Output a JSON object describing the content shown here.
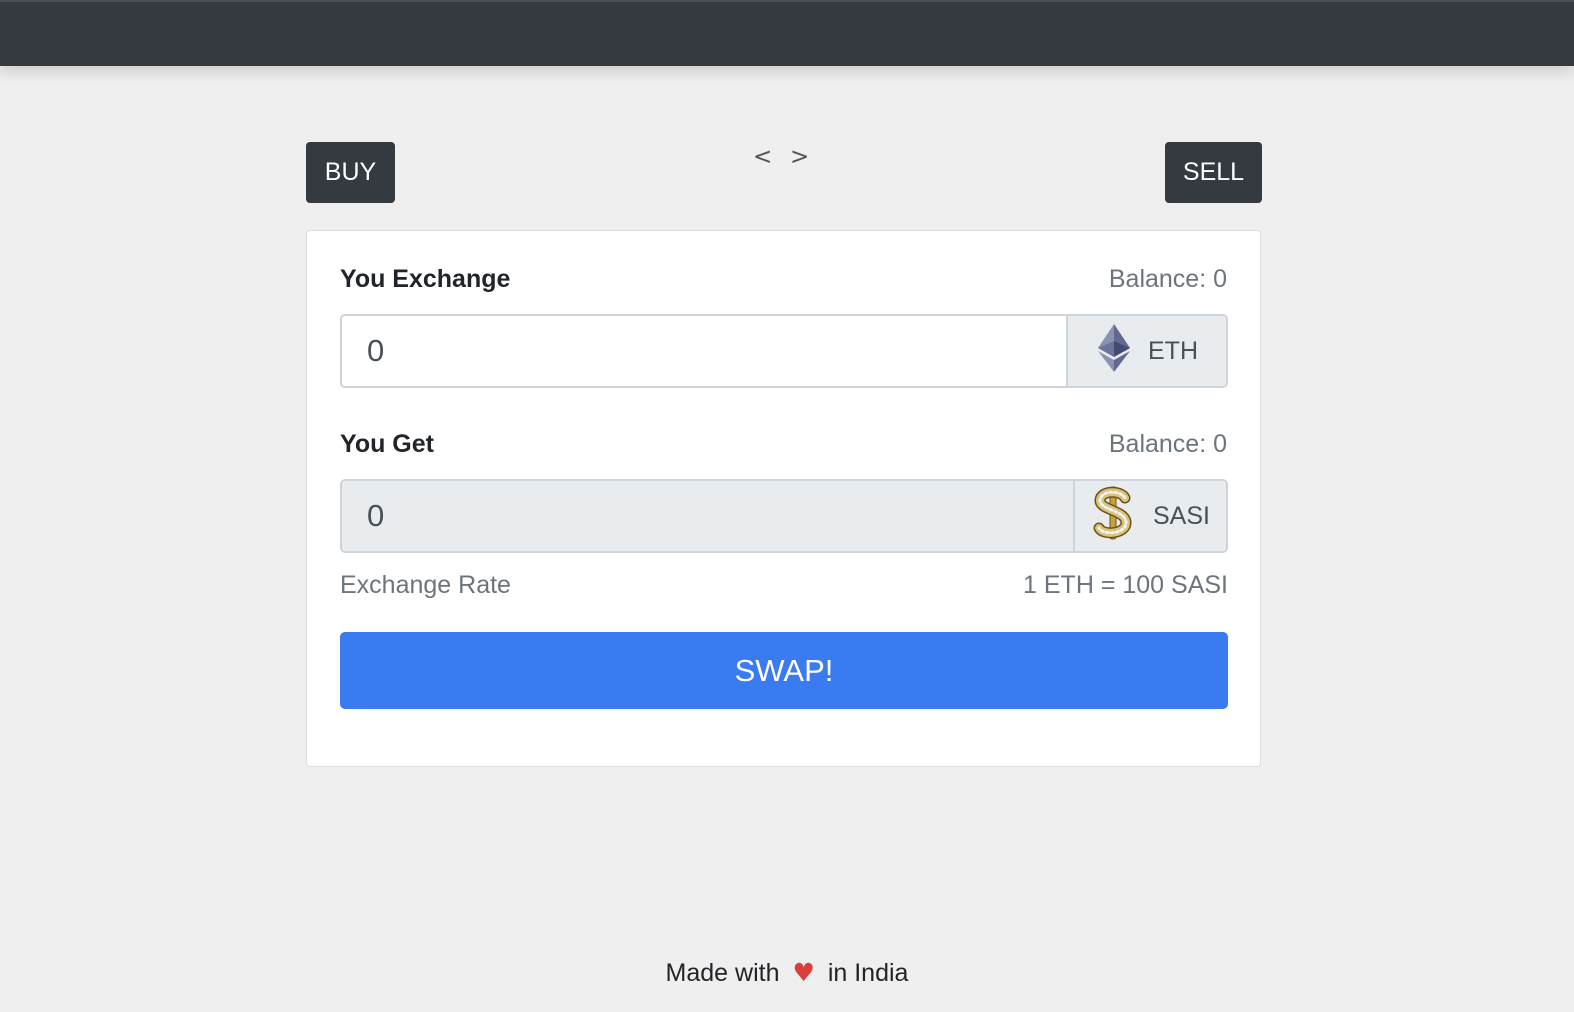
{
  "header": {
    "background": "#343a40"
  },
  "toggle": {
    "buy_label": "BUY",
    "sell_label": "SELL",
    "prev_symbol": "<",
    "next_symbol": ">"
  },
  "exchange": {
    "label": "You Exchange",
    "balance": "Balance: 0",
    "value": "0",
    "token": "ETH",
    "token_icon": "ethereum-icon"
  },
  "get": {
    "label": "You Get",
    "balance": "Balance: 0",
    "value": "0",
    "token": "SASI",
    "token_icon": "diamond-dollar-icon"
  },
  "rate": {
    "label": "Exchange Rate",
    "value": "1 ETH = 100 SASI"
  },
  "swap": {
    "label": "SWAP!",
    "color": "#3a7bf2"
  },
  "footer": {
    "prefix": "Made with",
    "heart": "♥",
    "suffix": "in India"
  }
}
